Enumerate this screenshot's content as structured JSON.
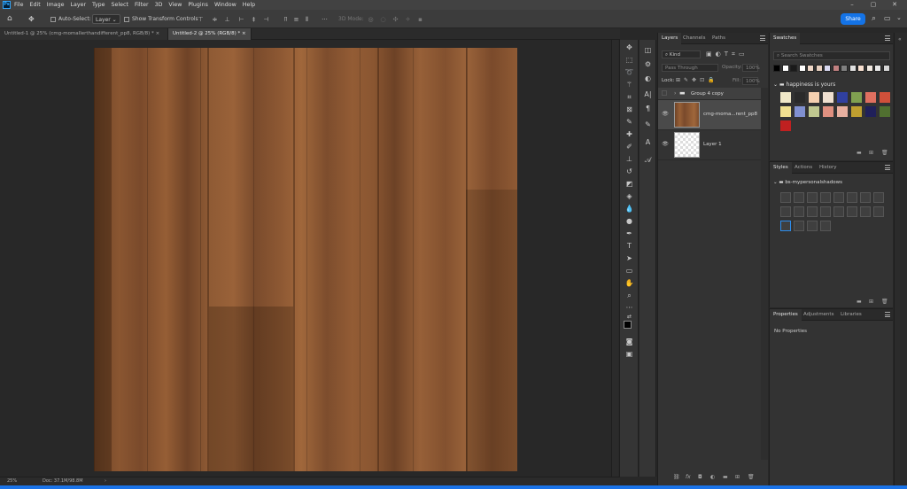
{
  "menubar": {
    "app_icon": "Ps",
    "items": [
      "File",
      "Edit",
      "Image",
      "Layer",
      "Type",
      "Select",
      "Filter",
      "3D",
      "View",
      "Plugins",
      "Window",
      "Help"
    ]
  },
  "optionsbar": {
    "auto_select_label": "Auto-Select:",
    "auto_select_target": "Layer",
    "show_transform_label": "Show Transform Controls",
    "mode_3d_label": "3D Mode:",
    "share_label": "Share"
  },
  "doc_tabs": [
    {
      "label": "Untitled-1 @ 25% (cmg-momallerthandifferent_pp8, RGB/8) *",
      "active": false
    },
    {
      "label": "Untitled-2 @ 25% (RGB/8) *",
      "active": true
    }
  ],
  "layers_panel": {
    "tabs": [
      "Layers",
      "Channels",
      "Paths"
    ],
    "filter_kind": "Kind",
    "blend_mode": "Pass Through",
    "opacity_label": "Opacity:",
    "opacity_value": "100%",
    "lock_label": "Lock:",
    "fill_label": "Fill:",
    "fill_value": "100%",
    "layers": [
      {
        "name": "Group 4 copy",
        "type": "group",
        "visible": false
      },
      {
        "name": "cmg-moma...rent_pp8",
        "type": "image",
        "visible": true
      },
      {
        "name": "Layer 1",
        "type": "empty",
        "visible": true
      }
    ]
  },
  "swatches_panel": {
    "tab": "Swatches",
    "search_placeholder": "Search Swatches",
    "group_name": "happiness is yours",
    "recent_colors": [
      "#000000",
      "#ffffff",
      "#1a1a1a",
      "#ffffff",
      "#f0d8c8",
      "#e8d0c0",
      "#d8d8f0",
      "#c08080",
      "#808080",
      "#e0e0e0",
      "#f8e0d0",
      "#f0e8e0",
      "#e8e8e8",
      "#d8d8d8"
    ],
    "group_colors": [
      "#f0e8c8",
      "#2a2a2a",
      "#f5d0b0",
      "#f0e0d0",
      "#3040a0",
      "#80a050",
      "#e07060",
      "#d0503a",
      "#f0e090",
      "#8090d0",
      "#c0c890",
      "#e09080",
      "#e8b0a0",
      "#c0a030",
      "#20205a",
      "#507030",
      "#c02020"
    ]
  },
  "styles_panel": {
    "tabs": [
      "Styles",
      "Actions",
      "History"
    ],
    "group_name": "bs-mypersonalshadows"
  },
  "properties_panel": {
    "tabs": [
      "Properties",
      "Adjustments",
      "Libraries"
    ],
    "content": "No Properties"
  },
  "statusbar": {
    "zoom": "25%",
    "doc_info": "Doc: 37.1M/98.8M"
  },
  "colors": {
    "accent": "#1473e6",
    "panel": "#333333",
    "canvas_bg": "#282828"
  }
}
